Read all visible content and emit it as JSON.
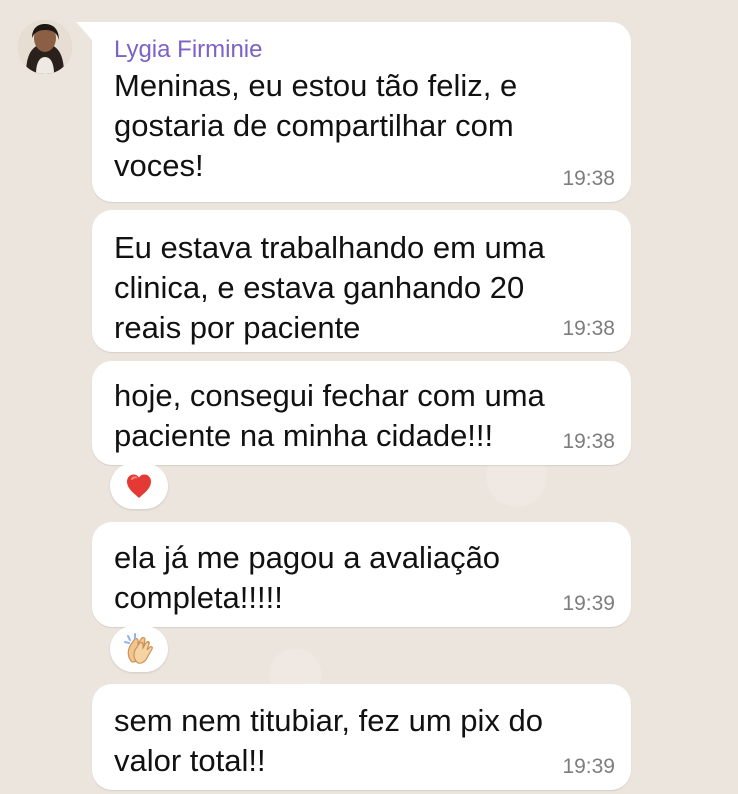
{
  "chat": {
    "sender_name": "Lygia Firminie",
    "messages": [
      {
        "text": "Meninas, eu estou tão feliz, e\ngostaria de compartilhar com\nvoces!",
        "time": "19:38"
      },
      {
        "text": "Eu estava trabalhando em uma\nclinica, e estava ganhando 20\nreais por paciente",
        "time": "19:38"
      },
      {
        "text": "hoje, consegui fechar com uma\npaciente na minha cidade!!!",
        "time": "19:38",
        "reaction": "heart-icon"
      },
      {
        "text": "ela já me pagou a avaliação\ncompleta!!!!!",
        "time": "19:39",
        "reaction": "clapping-hands-icon"
      },
      {
        "text": "sem nem titubiar, fez um pix do\nvalor total!!",
        "time": "19:39"
      }
    ]
  },
  "colors": {
    "background": "#ECE5DD",
    "bubble": "#FFFFFF",
    "sender": "#7B61C9",
    "text": "#111111",
    "time": "#7D7D7D"
  },
  "icons": {
    "avatar": "profile-photo",
    "reaction_1": "heart-icon",
    "reaction_2": "clapping-hands-icon"
  }
}
